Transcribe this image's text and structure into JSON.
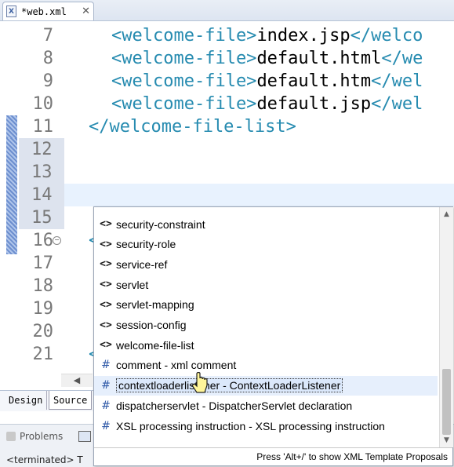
{
  "editor": {
    "tab_title": "*web.xml",
    "close_symbol": "✕",
    "icon_letter": "X",
    "lines": [
      {
        "num": "7",
        "open": "<welcome-file>",
        "text": "index.jsp",
        "close": "</welco"
      },
      {
        "num": "8",
        "open": "<welcome-file>",
        "text": "default.html",
        "close": "</we"
      },
      {
        "num": "9",
        "open": "<welcome-file>",
        "text": "default.htm",
        "close": "</wel"
      },
      {
        "num": "10",
        "open": "<welcome-file>",
        "text": "default.jsp",
        "close": "</wel"
      },
      {
        "num": "11",
        "code": "</welcome-file-list>"
      },
      {
        "num": "12"
      },
      {
        "num": "13"
      },
      {
        "num": "14"
      },
      {
        "num": "15"
      },
      {
        "num": "16",
        "code": "<"
      },
      {
        "num": "17"
      },
      {
        "num": "18"
      },
      {
        "num": "19"
      },
      {
        "num": "20"
      },
      {
        "num": "21",
        "code": "<"
      }
    ],
    "mode_tabs": {
      "design": "Design",
      "source": "Source"
    }
  },
  "bottom": {
    "problems_label": "Problems",
    "terminated_text": "<terminated> T"
  },
  "content_assist": {
    "proposals": [
      {
        "icon": "<>",
        "label": "security-constraint"
      },
      {
        "icon": "<>",
        "label": "security-role"
      },
      {
        "icon": "<>",
        "label": "service-ref"
      },
      {
        "icon": "<>",
        "label": "servlet"
      },
      {
        "icon": "<>",
        "label": "servlet-mapping"
      },
      {
        "icon": "<>",
        "label": "session-config"
      },
      {
        "icon": "<>",
        "label": "welcome-file-list"
      },
      {
        "icon": "#",
        "label": "comment - xml comment"
      },
      {
        "icon": "#",
        "label": "contextloaderlistener - ContextLoaderListener",
        "selected": true
      },
      {
        "icon": "#",
        "label": "dispatcherservlet - DispatcherServlet declaration"
      },
      {
        "icon": "#",
        "label": "XSL processing instruction - XSL processing instruction"
      }
    ],
    "status_text": "Press 'Alt+/' to show XML Template Proposals",
    "scrollbar": {
      "up": "▲",
      "down": "▼"
    }
  },
  "colors": {
    "tag": "#268bb0",
    "selection": "#dbe8fb",
    "change_marker": "#6d8fcf"
  }
}
